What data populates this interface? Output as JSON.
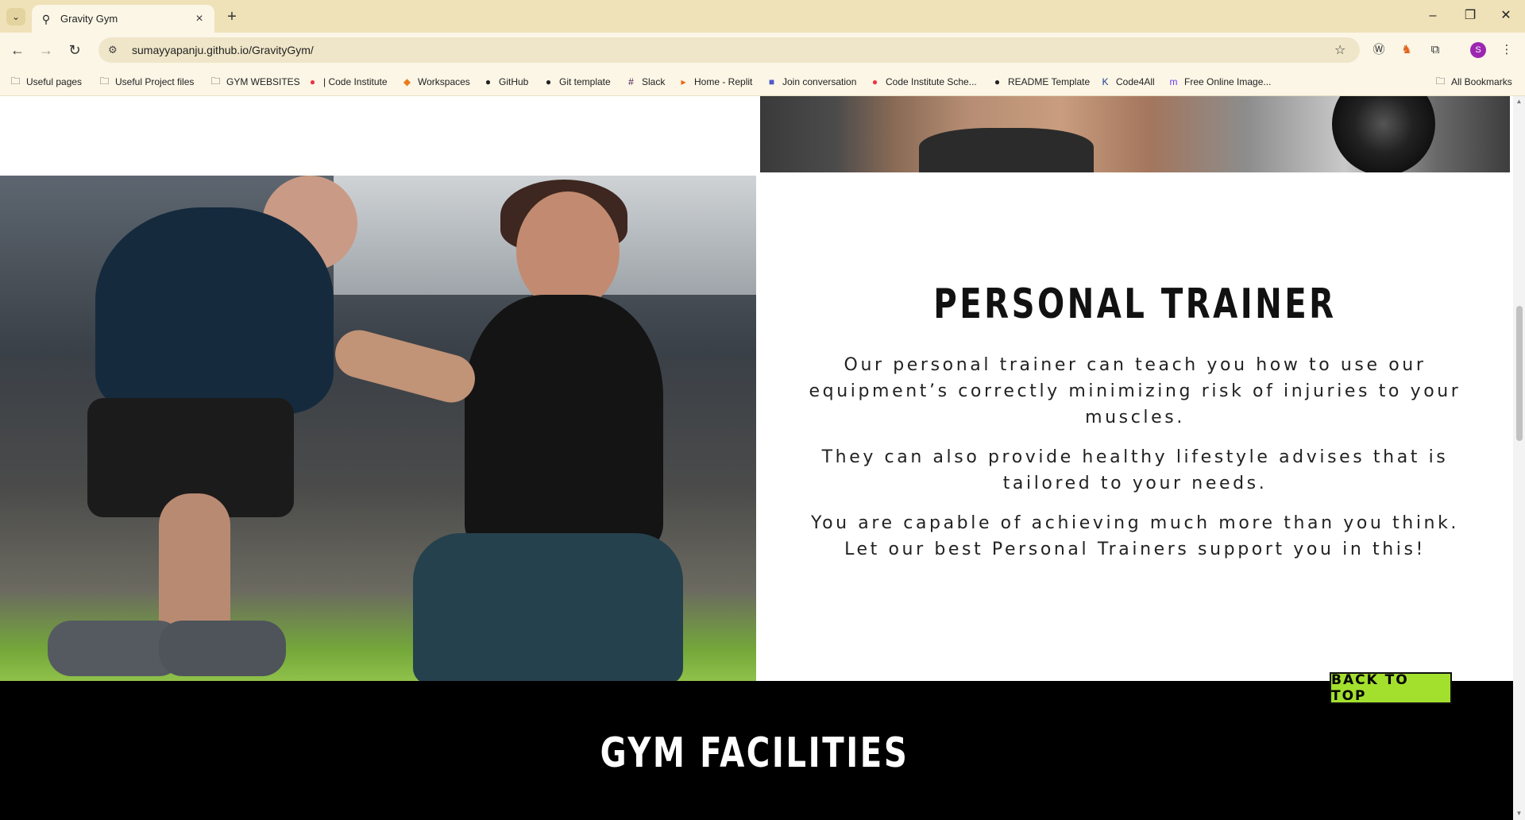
{
  "browser": {
    "tab": {
      "title": "Gravity Gym",
      "favicon": "dumbbell-figure-icon"
    },
    "new_tab": "+",
    "window_controls": {
      "minimize": "–",
      "restore": "❐",
      "close": "✕"
    },
    "url": "sumayyapanju.github.io/GravityGym/",
    "profile_initial": "S",
    "bookmarks": [
      {
        "label": "Useful pages",
        "icon": "folder-icon"
      },
      {
        "label": "Useful Project files",
        "icon": "folder-icon"
      },
      {
        "label": "GYM WEBSITES",
        "icon": "folder-icon"
      },
      {
        "label": "| Code Institute",
        "icon": "code-institute-icon"
      },
      {
        "label": "Workspaces",
        "icon": "gitpod-icon"
      },
      {
        "label": "GitHub",
        "icon": "github-icon"
      },
      {
        "label": "Git template",
        "icon": "github-icon"
      },
      {
        "label": "Slack",
        "icon": "slack-icon"
      },
      {
        "label": "Home - Replit",
        "icon": "replit-icon"
      },
      {
        "label": "Join conversation",
        "icon": "teams-icon"
      },
      {
        "label": "Code Institute Sche...",
        "icon": "code-institute-icon"
      },
      {
        "label": "README Template",
        "icon": "github-icon"
      },
      {
        "label": "Code4All",
        "icon": "k-icon"
      },
      {
        "label": "Free Online Image...",
        "icon": "image-icon"
      }
    ],
    "all_bookmarks": "All Bookmarks"
  },
  "page": {
    "personal_trainer": {
      "title": "PERSONAL TRAINER",
      "paragraphs": [
        "Our personal trainer can teach you how to use our equipment’s correctly minimizing risk of injuries to your muscles.",
        "They can also provide healthy lifestyle advises that is tailored to your needs.",
        "You are capable of achieving much more than you think. Let our best Personal Trainers support you in this!"
      ]
    },
    "facilities": {
      "title": "GYM FACILITIES"
    },
    "back_to_top": "BACK TO TOP",
    "colors": {
      "accent": "#a3e02e",
      "dark": "#000000"
    }
  }
}
